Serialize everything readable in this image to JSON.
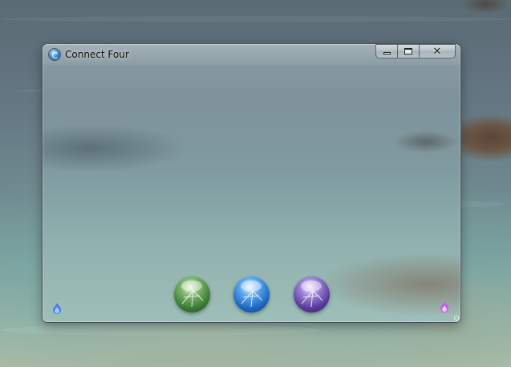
{
  "window": {
    "title": "Connect Four",
    "app_icon": "connect-four-app-icon",
    "controls": {
      "minimize_icon": "minimize-icon",
      "maximize_icon": "maximize-icon",
      "close_icon": "close-icon",
      "close_glyph": "✕"
    }
  },
  "game": {
    "player_pieces": [
      {
        "color_name": "green",
        "color": "#3c7c35",
        "icon": "green-orb-piece"
      },
      {
        "color_name": "blue",
        "color": "#1f68c3",
        "icon": "blue-orb-piece"
      },
      {
        "color_name": "purple",
        "color": "#5a3c9c",
        "icon": "purple-orb-piece"
      }
    ],
    "left_indicator": {
      "icon": "blue-flame-icon",
      "color": "#4a7cf0"
    },
    "right_indicator": {
      "icon": "purple-flame-icon",
      "color": "#c65cf0"
    }
  }
}
